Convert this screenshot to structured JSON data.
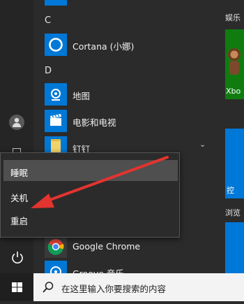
{
  "app_list": {
    "letters": [
      "C",
      "D"
    ],
    "apps": [
      {
        "label": "Cortana (小娜)",
        "icon": "cortana-icon"
      },
      {
        "label": "地图",
        "icon": "maps-icon"
      },
      {
        "label": "电影和电视",
        "icon": "movies-tv-icon"
      },
      {
        "label": "钉钉",
        "icon": "folder-icon"
      },
      {
        "label": "Google Chrome",
        "icon": "chrome-icon"
      },
      {
        "label": "Groove 音乐",
        "icon": "groove-music-icon"
      }
    ]
  },
  "tiles": {
    "groups": [
      "娱乐",
      "浏览"
    ],
    "xbox_label": "Xbo",
    "control_label": "控"
  },
  "power_menu": {
    "items": [
      {
        "label": "睡眠"
      },
      {
        "label": "关机"
      },
      {
        "label": "重启"
      }
    ]
  },
  "taskbar": {
    "search_placeholder": "在这里输入你要搜索的内容"
  },
  "colors": {
    "accent": "#0078d7",
    "annotation_arrow": "#e3342f",
    "menu_background": "#2b2b2b",
    "menu_highlight": "#4f4f4f"
  }
}
